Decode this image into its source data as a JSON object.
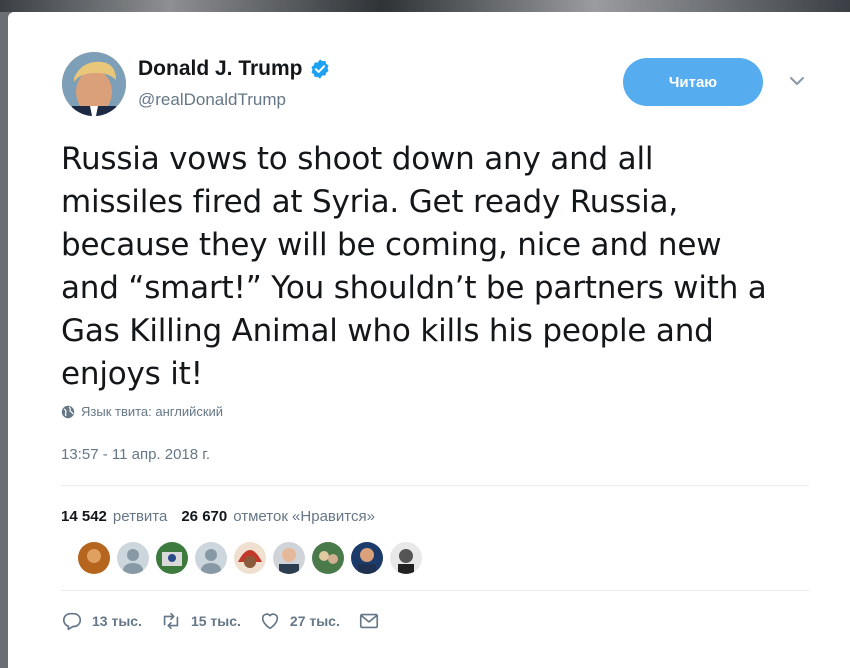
{
  "author": {
    "name": "Donald J. Trump",
    "handle": "@realDonaldTrump",
    "verified_icon": "verified-badge-icon",
    "avatar_icon": "profile-photo"
  },
  "follow_button": {
    "label": "Читаю"
  },
  "tweet": {
    "text": "Russia vows to shoot down any and all\nmissiles fired at Syria. Get ready Russia,\nbecause they will be coming, nice and new\nand “smart!” You shouldn’t be partners with a\nGas Killing Animal who kills his people and\nenjoys it!",
    "language_label": "Язык твита: английский",
    "timestamp": "13:57 - 11 апр. 2018 г."
  },
  "stats": {
    "retweets_count": "14 542",
    "retweets_label": "ретвита",
    "likes_count": "26 670",
    "likes_label": "отметок «Нравится»"
  },
  "likers_count_shown": 9,
  "actions": {
    "reply_count": "13 тыс.",
    "retweet_count": "15 тыс.",
    "like_count": "27 тыс."
  },
  "colors": {
    "accent": "#55acee",
    "secondary_text": "#657786",
    "primary_text": "#14171a"
  }
}
